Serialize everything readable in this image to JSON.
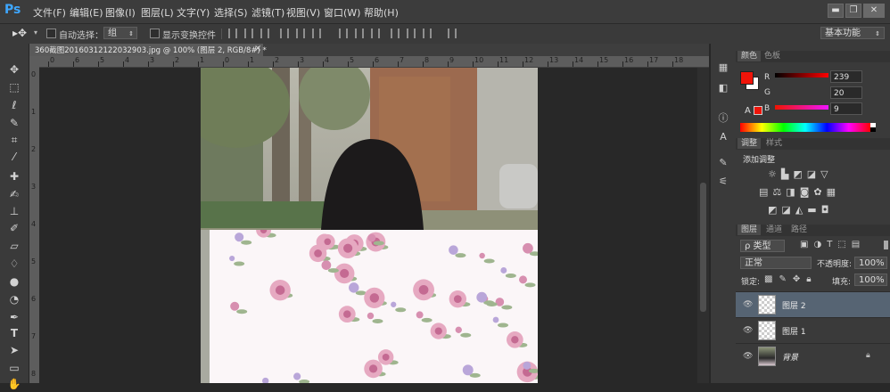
{
  "app": {
    "logo": "Ps"
  },
  "menu": [
    "文件(F)",
    "编辑(E)",
    "图像(I)",
    "图层(L)",
    "文字(Y)",
    "选择(S)",
    "滤镜(T)",
    "视图(V)",
    "窗口(W)",
    "帮助(H)"
  ],
  "window_controls": {
    "minimize": "▬",
    "restore": "❐",
    "close": "✕"
  },
  "options": {
    "auto_select_label": "自动选择：",
    "auto_select_value": "组",
    "show_transform_label": "显示变换控件",
    "workspace": "基本功能"
  },
  "document": {
    "tab_title": "360截图20160312122032903.jpg @ 100% (图层 2, RGB/8#) *",
    "tab_close": "×"
  },
  "rulers": {
    "h_labels": [
      "0",
      "6",
      "5",
      "4",
      "3",
      "2",
      "1",
      "0",
      "1",
      "2",
      "3",
      "4",
      "5",
      "6",
      "7",
      "8",
      "9",
      "10",
      "11",
      "12",
      "13",
      "14",
      "15",
      "16",
      "17",
      "18"
    ],
    "v_labels": [
      "0",
      "1",
      "2",
      "3",
      "4",
      "5",
      "6",
      "7",
      "8"
    ]
  },
  "color_panel": {
    "tabs": [
      "颜色",
      "色板"
    ],
    "r_label": "R",
    "g_label": "G",
    "b_label": "B",
    "r_value": "239",
    "g_value": "20",
    "b_value": "9",
    "fg_color": "#ef1409",
    "bg_color": "#ffffff"
  },
  "adjust_panel": {
    "tabs": [
      "调整",
      "样式"
    ],
    "title": "添加调整"
  },
  "layers_panel": {
    "tabs": [
      "图层",
      "通道",
      "路径"
    ],
    "kind_filter": "ρ 类型",
    "blend_mode": "正常",
    "opacity_label": "不透明度:",
    "opacity_value": "100%",
    "lock_label": "锁定:",
    "fill_label": "填充:",
    "fill_value": "100%",
    "layers": [
      {
        "name": "图层 2",
        "selected": true
      },
      {
        "name": "图层 1",
        "selected": false
      },
      {
        "name": "背景",
        "selected": false,
        "locked": true
      }
    ]
  },
  "icons": {
    "eye": "visibility-eye-icon",
    "lock": "lock-icon"
  }
}
